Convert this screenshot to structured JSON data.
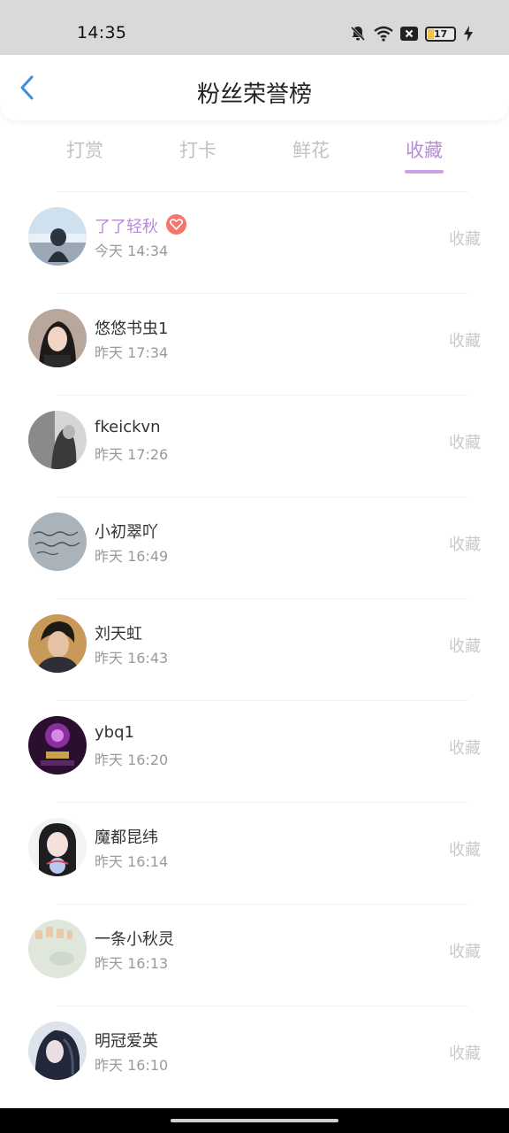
{
  "status_bar": {
    "time": "14:35",
    "battery_level": "17"
  },
  "header": {
    "title": "粉丝荣誉榜"
  },
  "tabs": [
    {
      "label": "打赏",
      "active": false
    },
    {
      "label": "打卡",
      "active": false
    },
    {
      "label": "鲜花",
      "active": false
    },
    {
      "label": "收藏",
      "active": true
    }
  ],
  "fans": [
    {
      "name": "了了轻秋",
      "time": "今天 14:34",
      "action": "收藏",
      "highlight": true,
      "badge_icon": "heart-gem-icon"
    },
    {
      "name": "悠悠书虫1",
      "time": "昨天 17:34",
      "action": "收藏"
    },
    {
      "name": "fkeickvn",
      "time": "昨天 17:26",
      "action": "收藏"
    },
    {
      "name": "小初翠吖",
      "time": "昨天 16:49",
      "action": "收藏"
    },
    {
      "name": "刘天虹",
      "time": "昨天 16:43",
      "action": "收藏"
    },
    {
      "name": "ybq1",
      "time": "昨天 16:20",
      "action": "收藏"
    },
    {
      "name": "魔都昆纬",
      "time": "昨天 16:14",
      "action": "收藏"
    },
    {
      "name": "一条小秋灵",
      "time": "昨天 16:13",
      "action": "收藏"
    },
    {
      "name": "明冠爱英",
      "time": "昨天 16:10",
      "action": "收藏"
    }
  ],
  "colors": {
    "accent": "#b98bd6",
    "badge": "#f5766f",
    "back_arrow": "#3b8fd9"
  }
}
